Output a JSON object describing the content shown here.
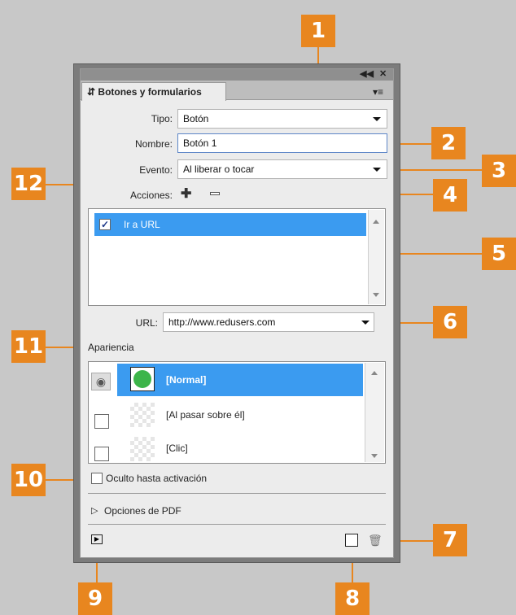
{
  "panel": {
    "title": "Botones y formularios",
    "topbar_icons": [
      "collapse-icon",
      "close-icon"
    ]
  },
  "fields": {
    "tipo_label": "Tipo:",
    "tipo_value": "Botón",
    "nombre_label": "Nombre:",
    "nombre_value": "Botón 1",
    "evento_label": "Evento:",
    "evento_value": "Al liberar o tocar",
    "acciones_label": "Acciones:"
  },
  "actions_list": [
    {
      "label": "Ir a URL",
      "checked": true,
      "selected": true
    }
  ],
  "url": {
    "label": "URL:",
    "value": "http://www.redusers.com"
  },
  "apariencia": {
    "label": "Apariencia",
    "states": [
      {
        "label": "[Normal]",
        "selected": true
      },
      {
        "label": "[Al pasar sobre él]",
        "selected": false
      },
      {
        "label": "[Clic]",
        "selected": false
      }
    ]
  },
  "oculto_label": "Oculto hasta activación",
  "pdf_label": "Opciones de PDF",
  "callouts": [
    "1",
    "2",
    "3",
    "4",
    "5",
    "6",
    "7",
    "8",
    "9",
    "10",
    "11",
    "12"
  ],
  "colors": {
    "accent": "#e8861f",
    "selection": "#3b9bf0",
    "state_green": "#3cb54a"
  }
}
